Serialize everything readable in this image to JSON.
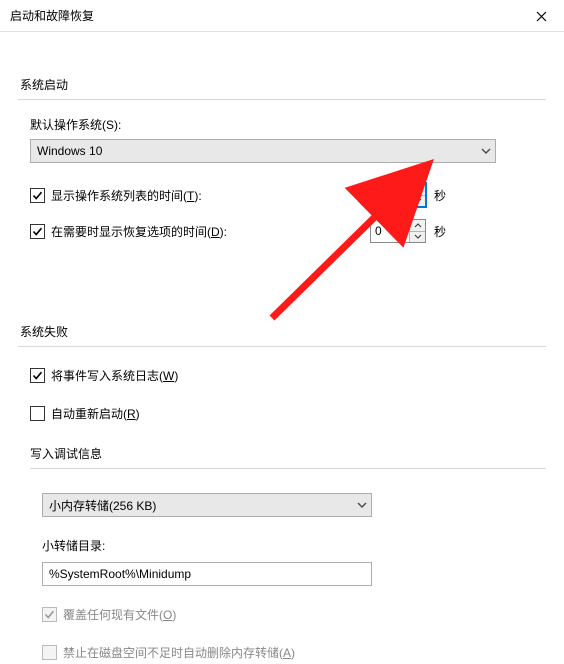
{
  "window": {
    "title": "启动和故障恢复"
  },
  "system_startup": {
    "header": "系统启动",
    "default_os_label": "默认操作系统(S):",
    "default_os_value": "Windows 10",
    "show_os_list": {
      "checked": true,
      "label_pre": "显示操作系统列表的时间(",
      "label_hot": "T",
      "label_post": "):",
      "value": "0",
      "suffix": "秒"
    },
    "show_recovery": {
      "checked": true,
      "label_pre": "在需要时显示恢复选项的时间(",
      "label_hot": "D",
      "label_post": "):",
      "value": "0",
      "suffix": "秒"
    }
  },
  "system_failure": {
    "header": "系统失败",
    "write_event": {
      "checked": true,
      "label_pre": "将事件写入系统日志(",
      "label_hot": "W",
      "label_post": ")"
    },
    "auto_restart": {
      "checked": false,
      "label_pre": "自动重新启动(",
      "label_hot": "R",
      "label_post": ")"
    },
    "debug_info": {
      "header": "写入调试信息",
      "type_value": "小内存转储(256 KB)",
      "dir_label": "小转储目录:",
      "dir_value": "%SystemRoot%\\Minidump",
      "overwrite": {
        "checked": true,
        "disabled": true,
        "label_pre": "覆盖任何现有文件(",
        "label_hot": "O",
        "label_post": ")"
      },
      "disable_low_disk": {
        "checked": false,
        "disabled": true,
        "label_pre": "禁止在磁盘空间不足时自动删除内存转储(",
        "label_hot": "A",
        "label_post": ")"
      }
    }
  }
}
